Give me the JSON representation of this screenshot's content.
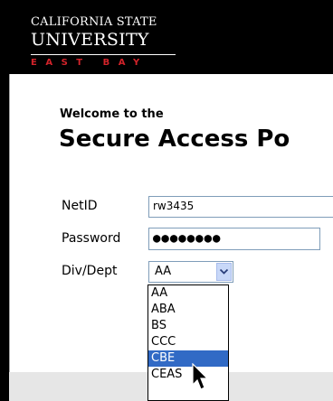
{
  "header": {
    "logo_line1": "CALIFORNIA STATE",
    "logo_line2": "UNIVERSITY",
    "logo_line3": "EAST BAY",
    "brand_red": "#d2232a"
  },
  "main": {
    "welcome": "Welcome to the",
    "title": "Secure Access Po"
  },
  "form": {
    "netid_label": "NetID",
    "netid_value": "rw3435",
    "password_label": "Password",
    "password_value": "●●●●●●●●",
    "divdept_label": "Div/Dept",
    "divdept_selected": "AA",
    "options": [
      "AA",
      "ABA",
      "BS",
      "CCC",
      "CBE",
      "CEAS"
    ],
    "highlighted_option": "CBE",
    "select_arrow_icon": "chevron-down-icon"
  },
  "colors": {
    "selection_blue": "#316ac5",
    "input_border": "#7f9db9"
  }
}
